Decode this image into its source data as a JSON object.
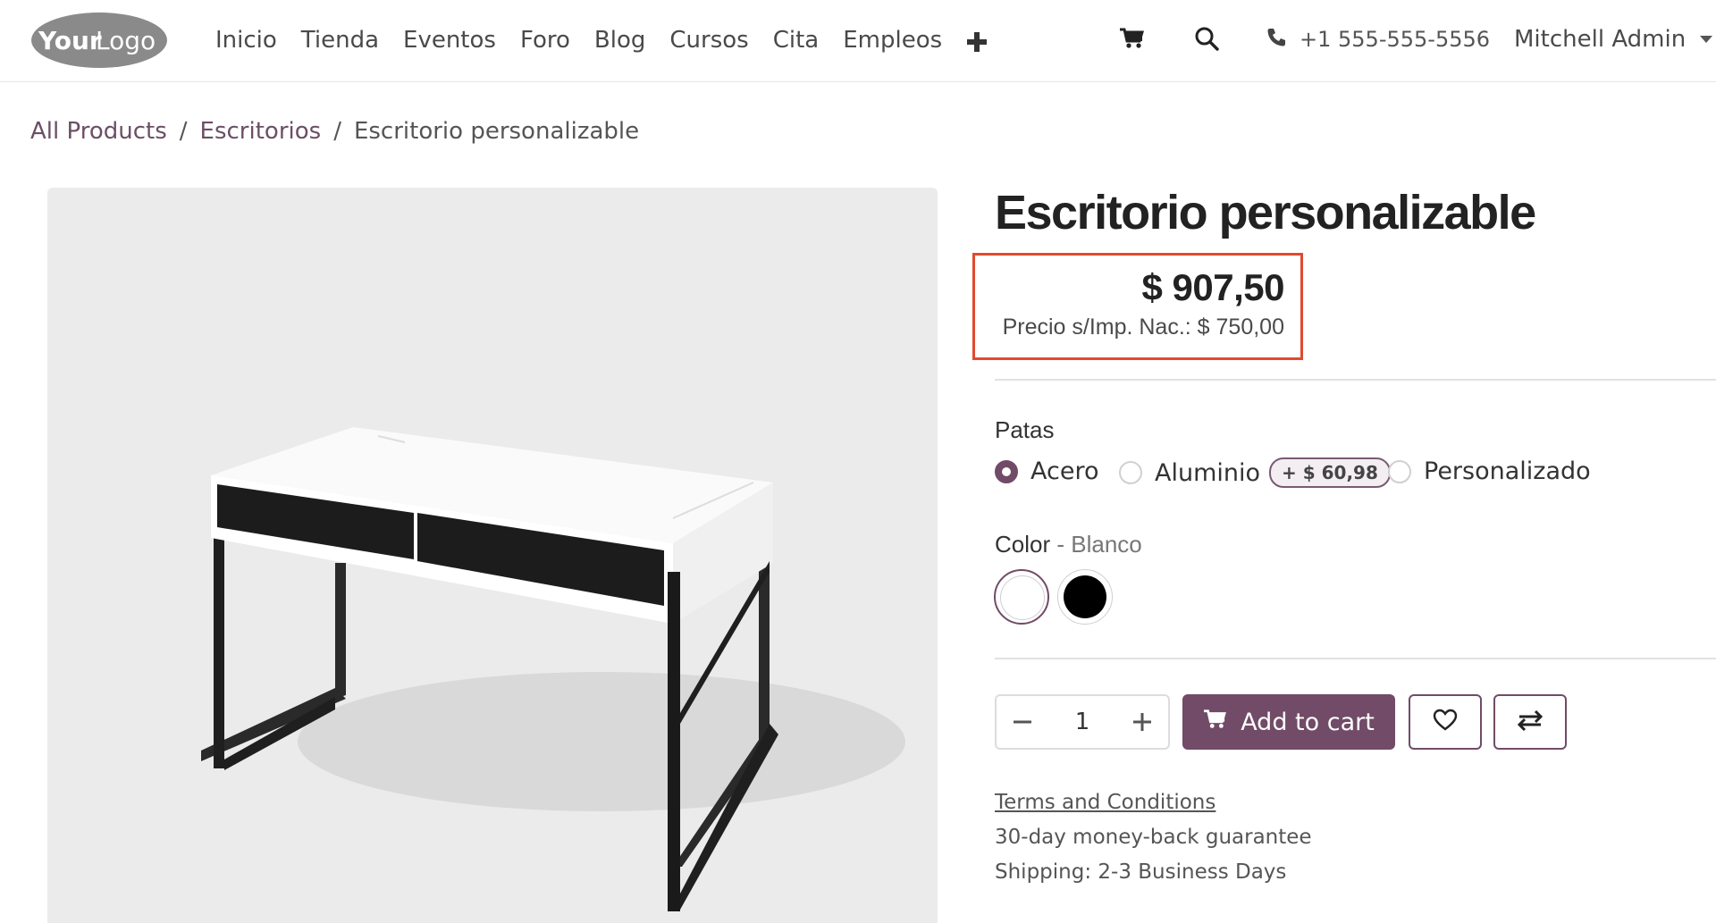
{
  "header": {
    "logo_text_bold": "Your",
    "logo_text_light": "Logo",
    "nav_items": [
      "Inicio",
      "Tienda",
      "Eventos",
      "Foro",
      "Blog",
      "Cursos",
      "Cita",
      "Empleos"
    ],
    "phone": "+1 555-555-5556",
    "user_name": "Mitchell Admin"
  },
  "breadcrumb": {
    "items": [
      "All Products",
      "Escritorios"
    ],
    "current": "Escritorio personalizable",
    "separator": "/"
  },
  "product": {
    "title": "Escritorio personalizable",
    "price": "$ 907,50",
    "price_tax_note": "Precio s/Imp. Nac.: $ 750,00"
  },
  "attributes": {
    "legs_label": "Patas",
    "legs_options": [
      {
        "label": "Acero",
        "selected": true
      },
      {
        "label": "Aluminio",
        "extra": "+ $ 60,98",
        "selected": false
      },
      {
        "label": "Personalizado",
        "selected": false
      }
    ],
    "color_label": "Color",
    "color_selected_sep": " - ",
    "color_selected": "Blanco",
    "color_swatches": [
      {
        "name": "white",
        "hex": "#ffffff",
        "selected": true
      },
      {
        "name": "black",
        "hex": "#000000",
        "selected": false
      }
    ]
  },
  "cart": {
    "quantity": "1",
    "add_to_cart_label": "Add to cart"
  },
  "info": {
    "terms_label": "Terms and Conditions",
    "guarantee": "30-day money-back guarantee",
    "shipping": "Shipping: 2-3 Business Days"
  },
  "colors": {
    "brand": "#714b67",
    "highlight_border": "#e04a2e",
    "image_bg": "#ebebeb"
  }
}
